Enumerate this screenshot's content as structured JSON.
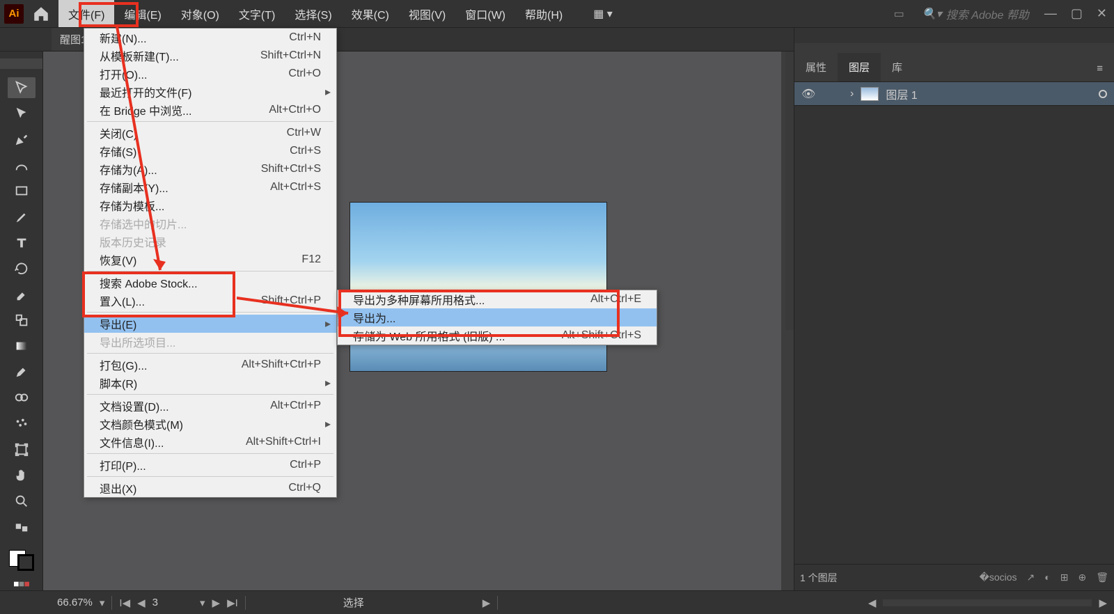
{
  "menubar": {
    "items": [
      "文件(F)",
      "编辑(E)",
      "对象(O)",
      "文字(T)",
      "选择(S)",
      "效果(C)",
      "视图(V)",
      "窗口(W)",
      "帮助(H)"
    ],
    "search_placeholder": "搜索 Adobe 帮助"
  },
  "tabbar": {
    "doc": "醒图1"
  },
  "file_menu": [
    {
      "label": "新建(N)...",
      "shortcut": "Ctrl+N"
    },
    {
      "label": "从模板新建(T)...",
      "shortcut": "Shift+Ctrl+N"
    },
    {
      "label": "打开(O)...",
      "shortcut": "Ctrl+O"
    },
    {
      "label": "最近打开的文件(F)",
      "arrow": true
    },
    {
      "label": "在 Bridge 中浏览...",
      "shortcut": "Alt+Ctrl+O"
    },
    {
      "sep": true
    },
    {
      "label": "关闭(C)",
      "shortcut": "Ctrl+W"
    },
    {
      "label": "存储(S)",
      "shortcut": "Ctrl+S"
    },
    {
      "label": "存储为(A)...",
      "shortcut": "Shift+Ctrl+S"
    },
    {
      "label": "存储副本(Y)...",
      "shortcut": "Alt+Ctrl+S"
    },
    {
      "label": "存储为模板..."
    },
    {
      "label": "存储选中的切片...",
      "disabled": true
    },
    {
      "label": "版本历史记录",
      "disabled": true
    },
    {
      "label": "恢复(V)",
      "shortcut": "F12"
    },
    {
      "sep": true
    },
    {
      "label": "搜索 Adobe Stock..."
    },
    {
      "label": "置入(L)...",
      "shortcut": "Shift+Ctrl+P"
    },
    {
      "sep": true
    },
    {
      "label": "导出(E)",
      "arrow": true,
      "hover": true
    },
    {
      "label": "导出所选项目...",
      "disabled": true
    },
    {
      "sep": true
    },
    {
      "label": "打包(G)...",
      "shortcut": "Alt+Shift+Ctrl+P"
    },
    {
      "label": "脚本(R)",
      "arrow": true
    },
    {
      "sep": true
    },
    {
      "label": "文档设置(D)...",
      "shortcut": "Alt+Ctrl+P"
    },
    {
      "label": "文档颜色模式(M)",
      "arrow": true
    },
    {
      "label": "文件信息(I)...",
      "shortcut": "Alt+Shift+Ctrl+I"
    },
    {
      "sep": true
    },
    {
      "label": "打印(P)...",
      "shortcut": "Ctrl+P"
    },
    {
      "sep": true
    },
    {
      "label": "退出(X)",
      "shortcut": "Ctrl+Q"
    }
  ],
  "export_menu": [
    {
      "label": "导出为多种屏幕所用格式...",
      "shortcut": "Alt+Ctrl+E"
    },
    {
      "label": "导出为...",
      "hover": true
    },
    {
      "label": "存储为 Web 所用格式 (旧版) ...",
      "shortcut": "Alt+Shift+Ctrl+S"
    }
  ],
  "panel": {
    "tabs": [
      "属性",
      "图层",
      "库"
    ],
    "layer_name": "图层 1",
    "status": "1 个图层"
  },
  "statusbar": {
    "zoom": "66.67%",
    "page": "3",
    "mode": "选择"
  }
}
